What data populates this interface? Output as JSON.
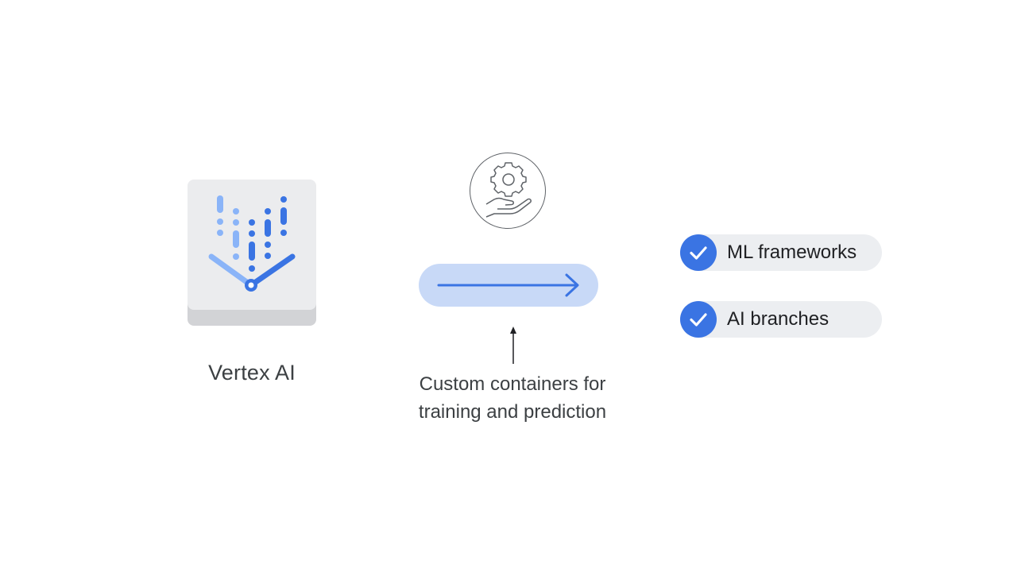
{
  "product": {
    "name": "Vertex AI",
    "icon": "vertex-ai-logo"
  },
  "center": {
    "top_icon": "gear-in-hand-icon",
    "flow_icon": "right-arrow-icon",
    "pointer_icon": "up-arrow-icon",
    "caption_line1": "Custom containers for",
    "caption_line2": "training and prediction"
  },
  "checklist": [
    {
      "label": "ML frameworks",
      "icon": "checkmark-icon",
      "checked": true
    },
    {
      "label": "AI branches",
      "icon": "checkmark-icon",
      "checked": true
    }
  ],
  "colors": {
    "accent_blue": "#3a74e3",
    "light_blue": "#8ab4f8",
    "pill_blue": "#c8d9f7",
    "text_dark": "#3c4043"
  }
}
